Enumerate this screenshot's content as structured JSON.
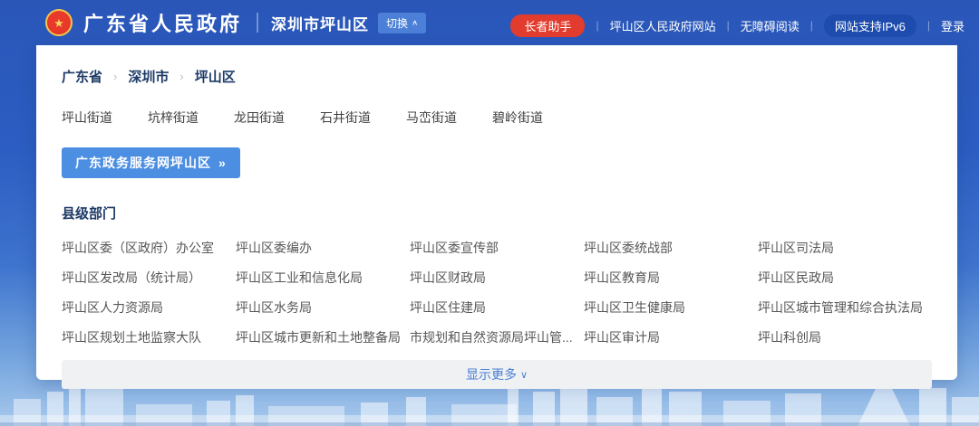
{
  "colors": {
    "header_blue": "#2a56b8",
    "accent_blue": "#4b8ee2",
    "badge_red": "#e23c2e",
    "badge_dark_blue": "#1d4cae",
    "navy_text": "#1d3a66",
    "link_gray": "#565656",
    "show_more_blue": "#4a7fd4"
  },
  "header": {
    "emblem_icon": "national-emblem",
    "emblem_glyph": "★",
    "site_title": "广东省人民政府",
    "district": "深圳市坪山区",
    "switch_button": {
      "label": "切换",
      "caret": "∧"
    },
    "nav": {
      "divider": "|",
      "elder_helper": "长者助手",
      "gov_site": "坪山区人民政府网站",
      "accessibility": "无障碍阅读",
      "ipv6": "网站支持IPv6",
      "login": "登录"
    }
  },
  "panel": {
    "breadcrumb": {
      "separator": "›",
      "items": [
        "广东省",
        "深圳市",
        "坪山区"
      ]
    },
    "streets": [
      "坪山街道",
      "坑梓街道",
      "龙田街道",
      "石井街道",
      "马峦街道",
      "碧岭街道"
    ],
    "service_button": {
      "label": "广东政务服务网坪山区",
      "arrow": "»"
    },
    "section_title": "县级部门",
    "departments": [
      "坪山区委（区政府）办公室",
      "坪山区委编办",
      "坪山区委宣传部",
      "坪山区委统战部",
      "坪山区司法局",
      "坪山区发改局（统计局）",
      "坪山区工业和信息化局",
      "坪山区财政局",
      "坪山区教育局",
      "坪山区民政局",
      "坪山区人力资源局",
      "坪山区水务局",
      "坪山区住建局",
      "坪山区卫生健康局",
      "坪山区城市管理和综合执法局",
      "坪山区规划土地监察大队",
      "坪山区城市更新和土地整备局",
      "市规划和自然资源局坪山管...",
      "坪山区审计局",
      "坪山科创局"
    ],
    "show_more": {
      "label": "显示更多",
      "caret": "∨"
    }
  }
}
